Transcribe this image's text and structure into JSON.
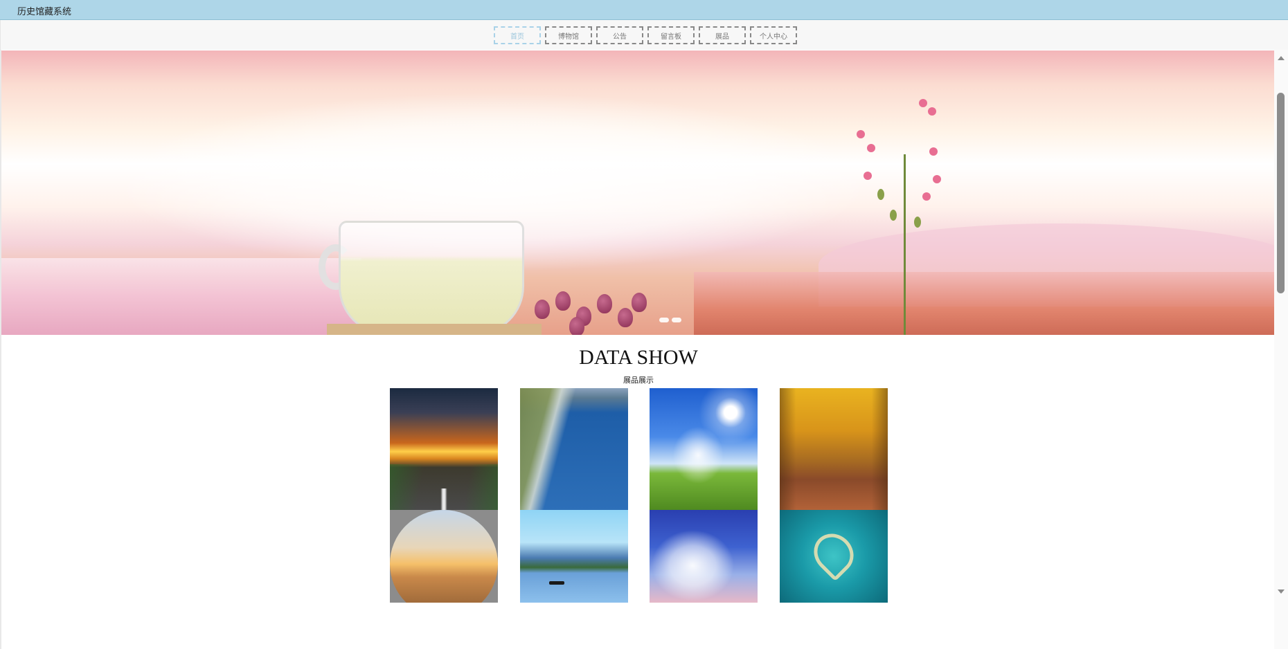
{
  "window": {
    "title": "历史馆藏系统"
  },
  "nav": {
    "items": [
      {
        "label": "首页",
        "active": true
      },
      {
        "label": "博物馆",
        "active": false
      },
      {
        "label": "公告",
        "active": false
      },
      {
        "label": "留言板",
        "active": false
      },
      {
        "label": "展品",
        "active": false
      },
      {
        "label": "个人中心",
        "active": false
      }
    ]
  },
  "banner": {
    "slide_count": 2
  },
  "section": {
    "title": "DATA SHOW",
    "subtitle": "展品展示"
  },
  "gallery": {
    "items": [
      {
        "scene": "sunset-road",
        "colors": [
          "#1c2a3a",
          "#e27a1c",
          "#3a3a3a"
        ]
      },
      {
        "scene": "coastline-aerial",
        "colors": [
          "#1e5ea8",
          "#6a8a4a",
          "#2a74c0"
        ]
      },
      {
        "scene": "sky-grass-hill",
        "colors": [
          "#2a6cd8",
          "#ffffff",
          "#5a9a2a"
        ]
      },
      {
        "scene": "autumn-tree-avenue",
        "colors": [
          "#e6a817",
          "#7a4a1a",
          "#b86a2a"
        ]
      },
      {
        "scene": "desert-sunset-circle",
        "colors": [
          "#8a8a8a",
          "#f2c27a",
          "#7a5030"
        ]
      },
      {
        "scene": "lake-boat",
        "colors": [
          "#8fd0f0",
          "#3a6aa0",
          "#2a4a8a"
        ]
      },
      {
        "scene": "clouds-blue-sky",
        "colors": [
          "#2a4ab8",
          "#ffffff",
          "#e8b0c0"
        ]
      },
      {
        "scene": "heart-island",
        "colors": [
          "#0e7a8a",
          "#3ac0c0",
          "#f0f0d0"
        ]
      }
    ]
  },
  "colors": {
    "titlebar": "#aed6e8",
    "nav_active": "#9cc6dc",
    "nav_border": "#888888"
  }
}
